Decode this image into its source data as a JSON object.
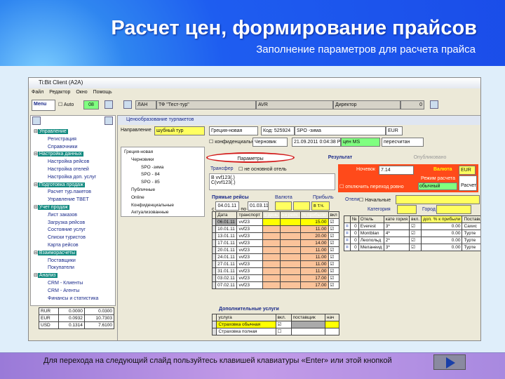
{
  "slide": {
    "title": "Расчет цен, формирование прайсов",
    "subtitle": "Заполнение параметров для расчета прайса",
    "footer": "Для перехода на следующий слайд пользуйтесь клавишей клавиатуры «Enter» или этой кнопкой"
  },
  "app": {
    "title": "Ti:Bit Client (A2A)",
    "menu": [
      "Файл",
      "Редактор",
      "Окно",
      "Помощь"
    ],
    "toolbar": {
      "menu_label": "Menu",
      "auto_label": "Auto",
      "badge": "08",
      "f1": "ЛАН",
      "f2": "ТФ \"Тест-тур\"",
      "f3": "AVR",
      "f4": "Директор",
      "f5": "0"
    },
    "tree": [
      {
        "label": "Управление",
        "children": [
          "Регистрация",
          "Справочники"
        ]
      },
      {
        "label": "Настройка данных",
        "children": [
          "Настройка рейсов",
          "Настройка отелей",
          "Настройка доп. услуг"
        ]
      },
      {
        "label": "Подготовка продаж",
        "children": [
          "Расчет тур.пакетов",
          "Управление ТВЕТ"
        ]
      },
      {
        "label": "Учет продаж",
        "children": [
          "Лист заказов",
          "Загрузка рейсов",
          "Состояние услуг",
          "Списки туристов",
          "Карта рейсов"
        ]
      },
      {
        "label": "Взаиморасчеты",
        "children": [
          "Поставщики",
          "Покупатели"
        ]
      },
      {
        "label": "Анализ",
        "children": [
          "CRM - Клиенты",
          "CRM - Агенты",
          "Финансы и статистика"
        ]
      }
    ],
    "currency": [
      [
        "RUR",
        "0.0000",
        "0.0300"
      ],
      [
        "EUR",
        "0.0932",
        "10.7303"
      ],
      [
        "USD",
        "0.1314",
        "7.6100"
      ]
    ]
  },
  "doc": {
    "title": "Ценообразование турпакетов",
    "direction_label": "Направление",
    "direction": "шубный тур",
    "country": "Греция-новая",
    "code_label": "Код:",
    "code": "525924",
    "name": "SPO -зима",
    "cur": "EUR",
    "conf_label": "конфиденциальный",
    "status": "Черновик",
    "date": "21.09.2011 0:04:38 PM",
    "prc_label": "цен",
    "prc_val": "MS",
    "recalc": "пересчитан",
    "left_tree": [
      "Греция-новая",
      "Черновики",
      "SPO -зима",
      "SPO - 84",
      "SPO - 85",
      "Публичные",
      "Online",
      "Конфиденциальные",
      "Актуализованные"
    ],
    "tabs": [
      "Параметры",
      "Результат",
      "Опубликовано"
    ],
    "transfer_label": "Трансфер",
    "hotel_label": "не основной отель",
    "trips": [
      "B vvf123(.)",
      "C(vvf123(.)"
    ],
    "nights_label": "Ночевок",
    "nights": "7.14",
    "currency_label": "Валюта",
    "currency": "EUR",
    "mode_label": "Режим расчета",
    "mode": "обычный",
    "calc_label": "Расчет",
    "sep_label": "отключить переход ровно",
    "flights": {
      "title": "Прямые рейсы",
      "from_label": "с",
      "from": "04.01.11",
      "to_label": "по",
      "to": "01.03.11",
      "cur_label": "Валюта",
      "profit_label": "Прибыль",
      "profit_unit": "в т.ч.",
      "cols": [
        "Дата",
        "транспорт",
        "в день",
        "на рейс",
        "% прибыли",
        "вкл"
      ],
      "rows": [
        [
          "06.01.11",
          "vvf23",
          "15.00"
        ],
        [
          "10.01.11",
          "vvf23",
          "11.00"
        ],
        [
          "13.01.11",
          "vvf23",
          "20.00"
        ],
        [
          "17.01.11",
          "vvf23",
          "14.00"
        ],
        [
          "20.01.11",
          "vvf23",
          "11.00"
        ],
        [
          "24.01.11",
          "vvf23",
          "11.00"
        ],
        [
          "27.01.11",
          "vvf23",
          "11.00"
        ],
        [
          "31.01.11",
          "vvf23",
          "11.00"
        ],
        [
          "03.02.11",
          "vvf23",
          "17.00"
        ],
        [
          "07.02.11",
          "vvf23",
          "17.00"
        ]
      ]
    },
    "services": {
      "title": "Дополнительные услуги",
      "cols": [
        "услуга",
        "вкл.",
        "поставщик",
        "нач"
      ],
      "rows": [
        [
          "Страховка обычная"
        ],
        [
          "Страховка полная"
        ]
      ]
    },
    "hotels": {
      "title": "Отели",
      "initial_label": "Начальные",
      "category_label": "Категория",
      "city_label": "Город",
      "cols": [
        "№",
        "Отель",
        "кате гория",
        "вкл.",
        "доп. % к прибыли",
        "Поставщик",
        "Город"
      ],
      "rows": [
        [
          "0",
          "Everest",
          "3*",
          "0.00",
          "Сахис",
          "Хало"
        ],
        [
          "0",
          "Montblan",
          "4*",
          "0.00",
          "Турте",
          "Хало"
        ],
        [
          "0",
          "Леопольд",
          "2*",
          "0.00",
          "Турте",
          "с.Коз"
        ],
        [
          "0",
          "Меланеид",
          "3*",
          "0.00",
          "Турте",
          "с.Кор"
        ]
      ]
    }
  }
}
